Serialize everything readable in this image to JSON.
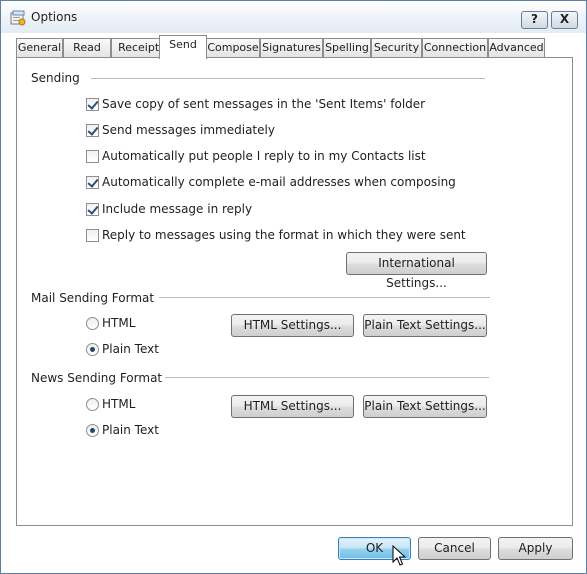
{
  "window": {
    "title": "Options",
    "help_label": "?",
    "close_label": "X"
  },
  "tabs": [
    {
      "label": "General"
    },
    {
      "label": "Read"
    },
    {
      "label": "Receipts"
    },
    {
      "label": "Send",
      "active": true
    },
    {
      "label": "Compose"
    },
    {
      "label": "Signatures"
    },
    {
      "label": "Spelling"
    },
    {
      "label": "Security"
    },
    {
      "label": "Connection"
    },
    {
      "label": "Advanced"
    }
  ],
  "sending": {
    "heading": "Sending",
    "options": [
      {
        "label": "Save copy of sent messages in the 'Sent Items' folder",
        "checked": true
      },
      {
        "label": "Send messages immediately",
        "checked": true
      },
      {
        "label": "Automatically put people I reply to in my Contacts list",
        "checked": false
      },
      {
        "label": "Automatically complete e-mail addresses when composing",
        "checked": true
      },
      {
        "label": "Include message in reply",
        "checked": true
      },
      {
        "label": "Reply to messages using the format in which they were sent",
        "checked": false
      }
    ],
    "international_button": "International Settings..."
  },
  "mail_format": {
    "heading": "Mail Sending Format",
    "html_label": "HTML",
    "plain_label": "Plain Text",
    "selected": "Plain Text",
    "html_settings_button": "HTML Settings...",
    "plain_settings_button": "Plain Text Settings..."
  },
  "news_format": {
    "heading": "News Sending Format",
    "html_label": "HTML",
    "plain_label": "Plain Text",
    "selected": "Plain Text",
    "html_settings_button": "HTML Settings...",
    "plain_settings_button": "Plain Text Settings..."
  },
  "footer": {
    "ok": "OK",
    "cancel": "Cancel",
    "apply": "Apply"
  }
}
